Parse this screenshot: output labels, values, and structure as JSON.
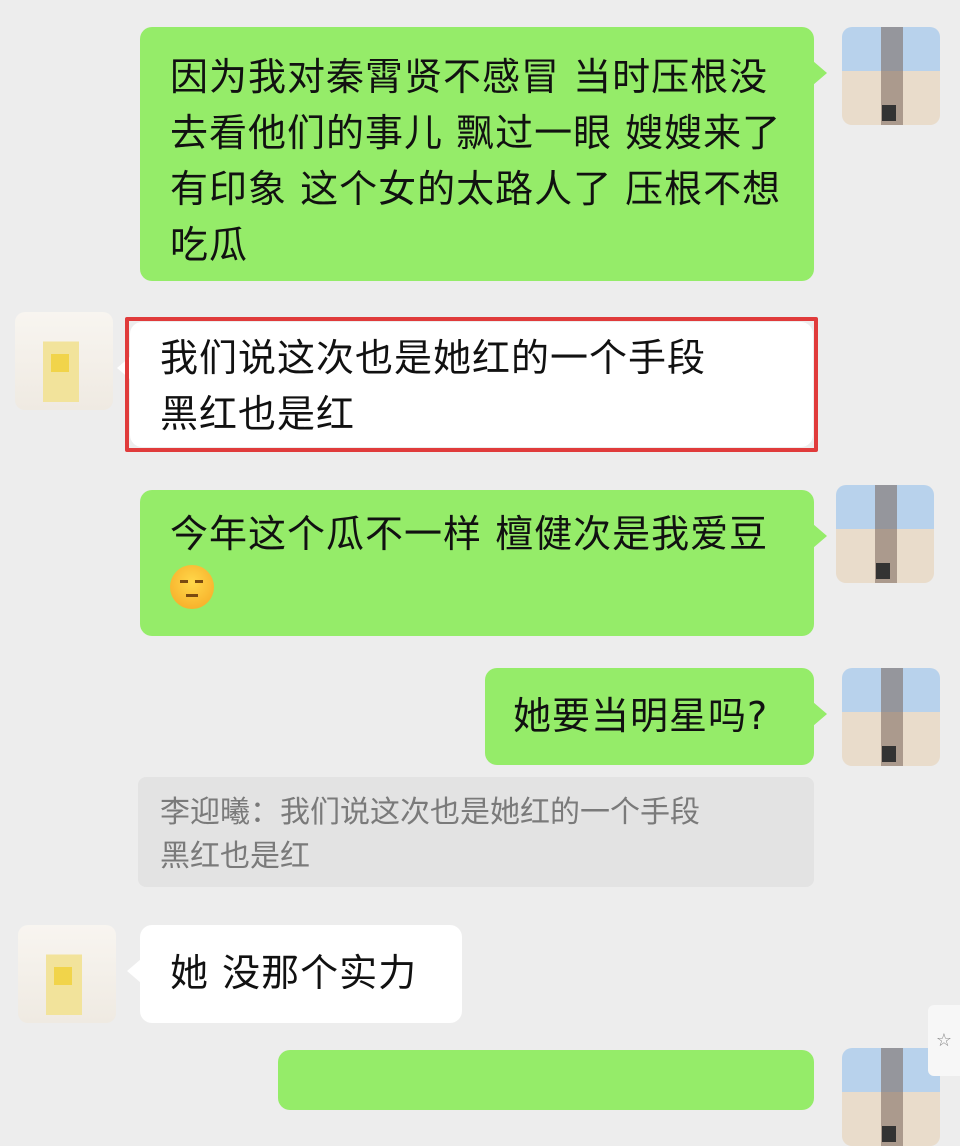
{
  "messages": [
    {
      "side": "right",
      "text": "因为我对秦霄贤不感冒 当时压根没去看他们的事儿 飘过一眼 嫂嫂来了 有印象 这个女的太路人了 压根不想吃瓜"
    },
    {
      "side": "left",
      "text_line1": "我们说这次也是她红的一个手段",
      "text_line2": "黑红也是红",
      "highlighted": true
    },
    {
      "side": "right",
      "text": "今年这个瓜不一样 檀健次是我爱豆",
      "emoji": "unamused-face"
    },
    {
      "side": "right",
      "text": "她要当明星吗?"
    },
    {
      "side": "left",
      "text": "她 没那个实力"
    }
  ],
  "quote": {
    "line1": "李迎曦：我们说这次也是她红的一个手段",
    "line2": "黑红也是红"
  },
  "side_badge": "☆",
  "colors": {
    "background": "#ededed",
    "sent_bubble": "#95ec69",
    "received_bubble": "#ffffff",
    "highlight_border": "#e03b3b",
    "quote_bg": "#e3e3e3"
  }
}
